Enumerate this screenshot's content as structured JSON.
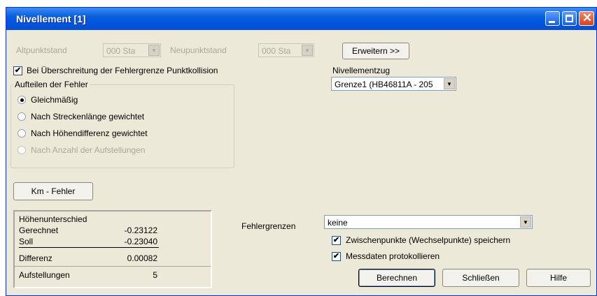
{
  "window": {
    "title": "Nivellement [1]"
  },
  "top": {
    "altpunktstand_label": "Altpunktstand",
    "altpunktstand_value": "000  Sta",
    "neupunktstand_label": "Neupunktstand",
    "neupunktstand_value": "000  Sta",
    "erweitern_button": "Erweitern >>"
  },
  "collision": {
    "label": "Bei Überschreitung der Fehlergrenze Punktkollision",
    "checked": true
  },
  "fehler_group": {
    "legend": "Aufteilen der Fehler",
    "options": [
      {
        "label": "Gleichmäßig",
        "selected": true,
        "enabled": true
      },
      {
        "label": "Nach Streckenlänge gewichtet",
        "selected": false,
        "enabled": true
      },
      {
        "label": "Nach Höhendifferenz gewichtet",
        "selected": false,
        "enabled": true
      },
      {
        "label": "Nach Anzahl der Aufstellungen",
        "selected": false,
        "enabled": false
      }
    ]
  },
  "nivellementzug": {
    "label": "Nivellementzug",
    "value": "Grenze1 (HB46811A - 205"
  },
  "km_fehler_button": "Km - Fehler",
  "info": {
    "heading": "Höhenunterschied",
    "gerechnet_label": "Gerechnet",
    "gerechnet_value": "-0.23122",
    "soll_label": "Soll",
    "soll_value": "-0.23040",
    "differenz_label": "Differenz",
    "differenz_value": "0.00082",
    "aufstellungen_label": "Aufstellungen",
    "aufstellungen_value": "5"
  },
  "fehlergrenzen": {
    "label": "Fehlergrenzen",
    "value": "keine"
  },
  "zwischenpunkte": {
    "label": "Zwischenpunkte (Wechselpunkte) speichern",
    "checked": true
  },
  "messdaten": {
    "label": "Messdaten protokollieren",
    "checked": true
  },
  "buttons": {
    "berechnen": "Berechnen",
    "schliessen": "Schließen",
    "hilfe": "Hilfe"
  },
  "checkmark": "✔",
  "colors": {
    "titlebar": "#0054e3",
    "dialog_bg": "#ece9d8",
    "disabled_text": "#aca899"
  }
}
